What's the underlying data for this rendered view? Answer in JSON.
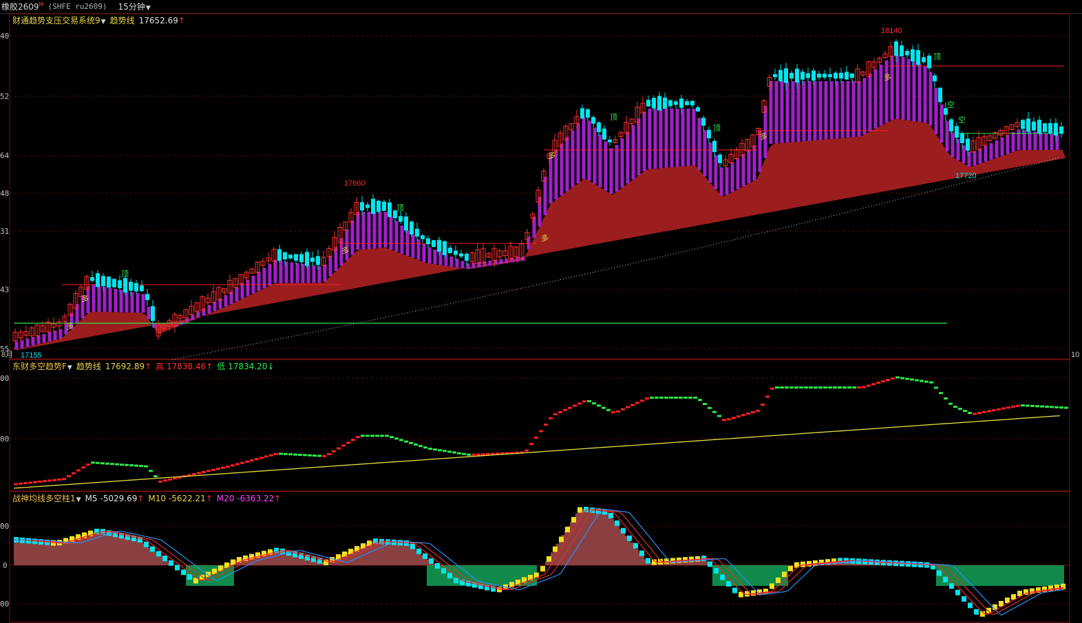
{
  "toolbar": {
    "symbol_name": "橡胶2609",
    "symbol_sup": "M",
    "symbol_code": "(SHFE ru2609)",
    "period": "15分钟"
  },
  "panel_main": {
    "indicator_name": "财通趋势支压交易系统9",
    "trend_label": "趋势线",
    "trend_value": "17652.69",
    "trend_arrow": "↑",
    "axis_ticks": [
      "40",
      "52",
      "64",
      "48",
      "31",
      "43",
      "55"
    ],
    "high_label": "18140",
    "low_label": "17720",
    "peak_label": "17660",
    "bottom_left_label": "8月",
    "bottom_low_label": "17155",
    "right_edge_label": "10",
    "signal_buy": "多",
    "signal_top": "顶",
    "signal_short": "空"
  },
  "panel_mid": {
    "indicator_name": "东财多空趋势F",
    "trend_label": "趋势线",
    "trend_value": "17692.89",
    "high_label": "高",
    "high_value": "17838.46",
    "low_label": "低",
    "low_value": "17834.20",
    "up_arrow": "↑",
    "down_arrow": "↓",
    "axis_ticks": [
      "00",
      "00"
    ]
  },
  "panel_bottom": {
    "indicator_name": "战神均线多空柱1",
    "m5_label": "M5",
    "m5_value": "-5029.69",
    "m10_label": "M10",
    "m10_value": "-5622.21",
    "m20_label": "M20",
    "m20_value": "-6363.22",
    "up_arrow": "↑",
    "axis_ticks": [
      "00",
      "0",
      "00"
    ]
  },
  "colors": {
    "candle_up": "#ff3030",
    "candle_down": "#00e5ee",
    "band_fill": "#9b1d1d",
    "purple_bars": "#a020c8",
    "trend_green": "#2ee84b",
    "trend_red": "#ff2020",
    "yellow_line": "#e8e040",
    "hist_green": "#0f8a4a",
    "hist_red": "#8a4040"
  }
}
